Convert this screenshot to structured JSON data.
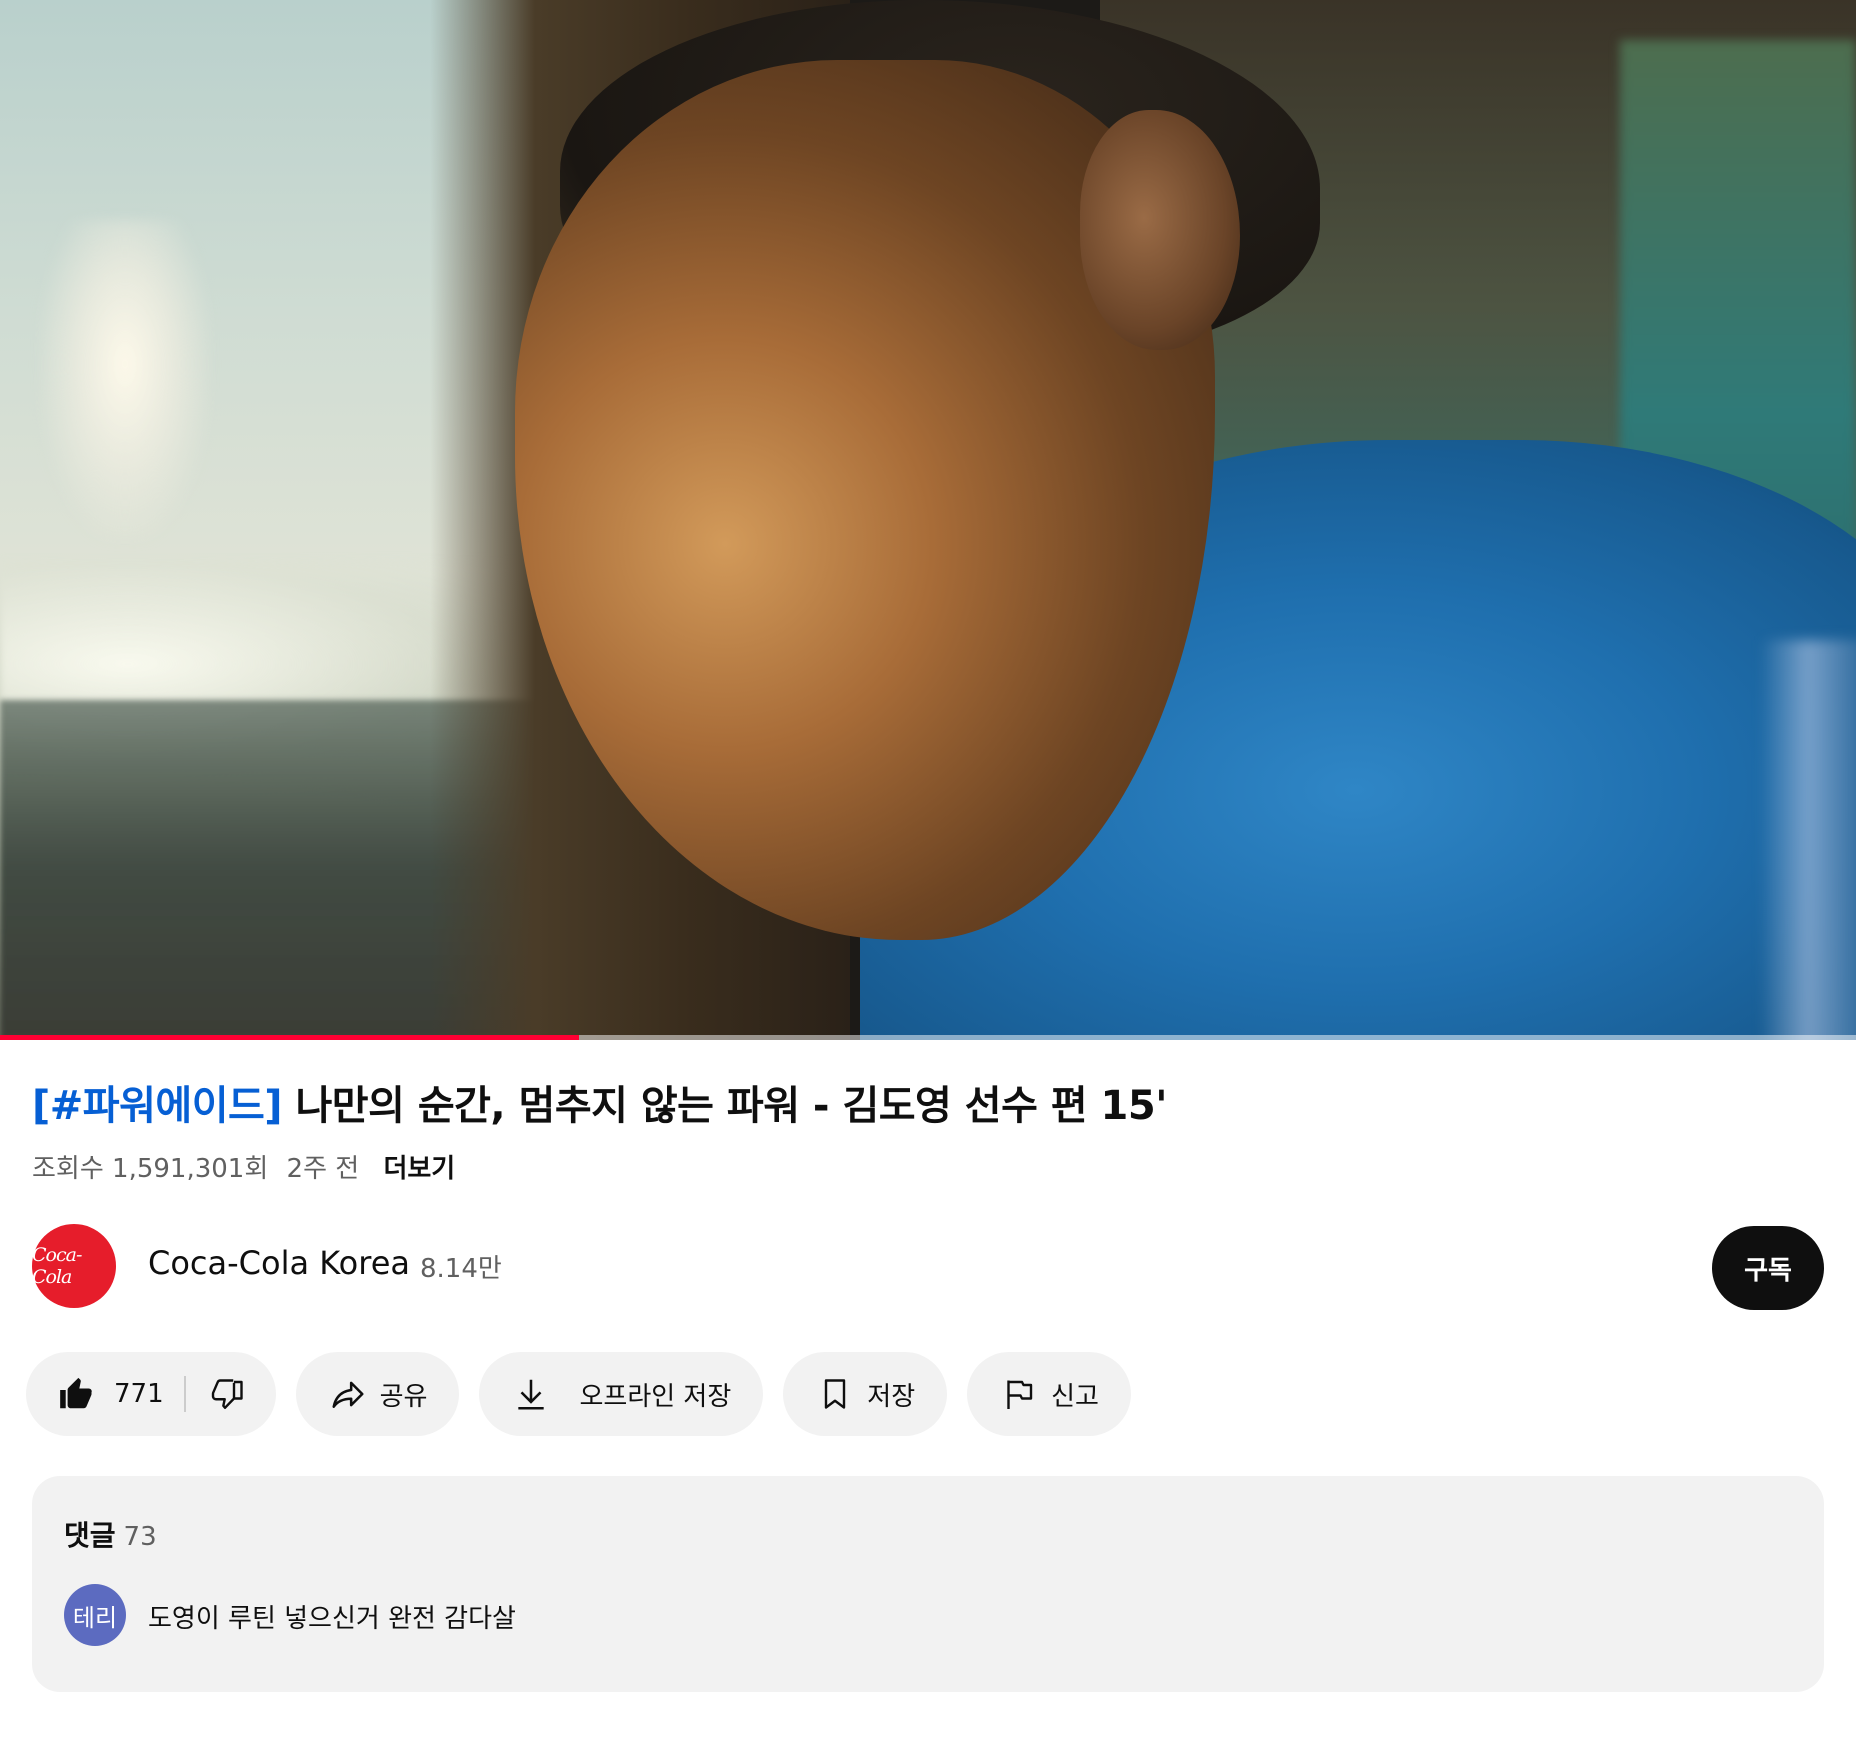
{
  "video": {
    "progress_fraction": 0.312,
    "progress_color": "#ff0033"
  },
  "title": {
    "tag": "[#파워에이드]",
    "rest": " 나만의 순간, 멈추지 않는 파워 - 김도영 선수 편 15'"
  },
  "meta": {
    "views": "조회수 1,591,301회",
    "age": "2주 전",
    "more": "더보기"
  },
  "channel": {
    "logo_text": "Coca-Cola",
    "name": "Coca-Cola Korea",
    "subscribers": "8.14만",
    "subscribe_label": "구독",
    "brand_color": "#e61d2b"
  },
  "actions": {
    "like_count": "771",
    "share_label": "공유",
    "download_label": "오프라인 저장",
    "save_label": "저장",
    "report_label": "신고",
    "icons": [
      "thumbs-up-icon",
      "thumbs-down-icon",
      "share-icon",
      "download-icon",
      "bookmark-icon",
      "flag-icon"
    ]
  },
  "comments": {
    "label": "댓글",
    "count": "73",
    "top_comment": {
      "avatar_text": "테리",
      "avatar_color": "#5c6bc0",
      "text": "도영이 루틴 넣으신거 완전 감다살"
    }
  }
}
